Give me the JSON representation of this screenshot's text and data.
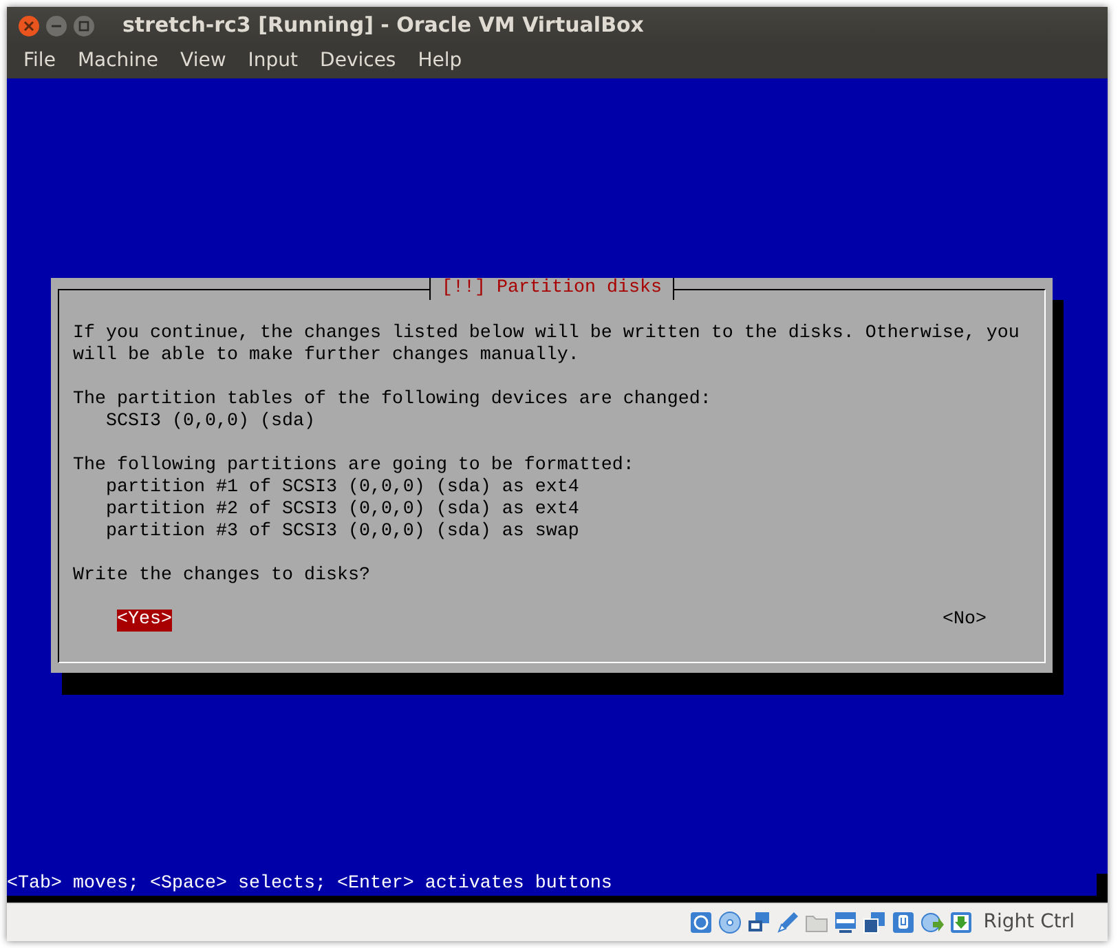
{
  "window": {
    "title": "stretch-rc3 [Running] - Oracle VM VirtualBox"
  },
  "menu": [
    "File",
    "Machine",
    "View",
    "Input",
    "Devices",
    "Help"
  ],
  "dialog": {
    "title": "[!!] Partition disks",
    "blocks": [
      {
        "text": "If you continue, the changes listed below will be written to the disks. Otherwise, you will be able to make further changes manually."
      },
      {
        "text": "The partition tables of the following devices are changed:",
        "items": [
          "SCSI3 (0,0,0) (sda)"
        ]
      },
      {
        "text": "The following partitions are going to be formatted:",
        "items": [
          "partition #1 of SCSI3 (0,0,0) (sda) as ext4",
          "partition #2 of SCSI3 (0,0,0) (sda) as ext4",
          "partition #3 of SCSI3 (0,0,0) (sda) as swap"
        ]
      },
      {
        "text": "Write the changes to disks?"
      }
    ],
    "buttons": [
      {
        "label": "<Yes>",
        "selected": true
      },
      {
        "label": "<No>",
        "selected": false
      }
    ]
  },
  "help_line": "<Tab> moves; <Space> selects; <Enter> activates buttons",
  "status_bar": {
    "host_key": "Right Ctrl"
  }
}
